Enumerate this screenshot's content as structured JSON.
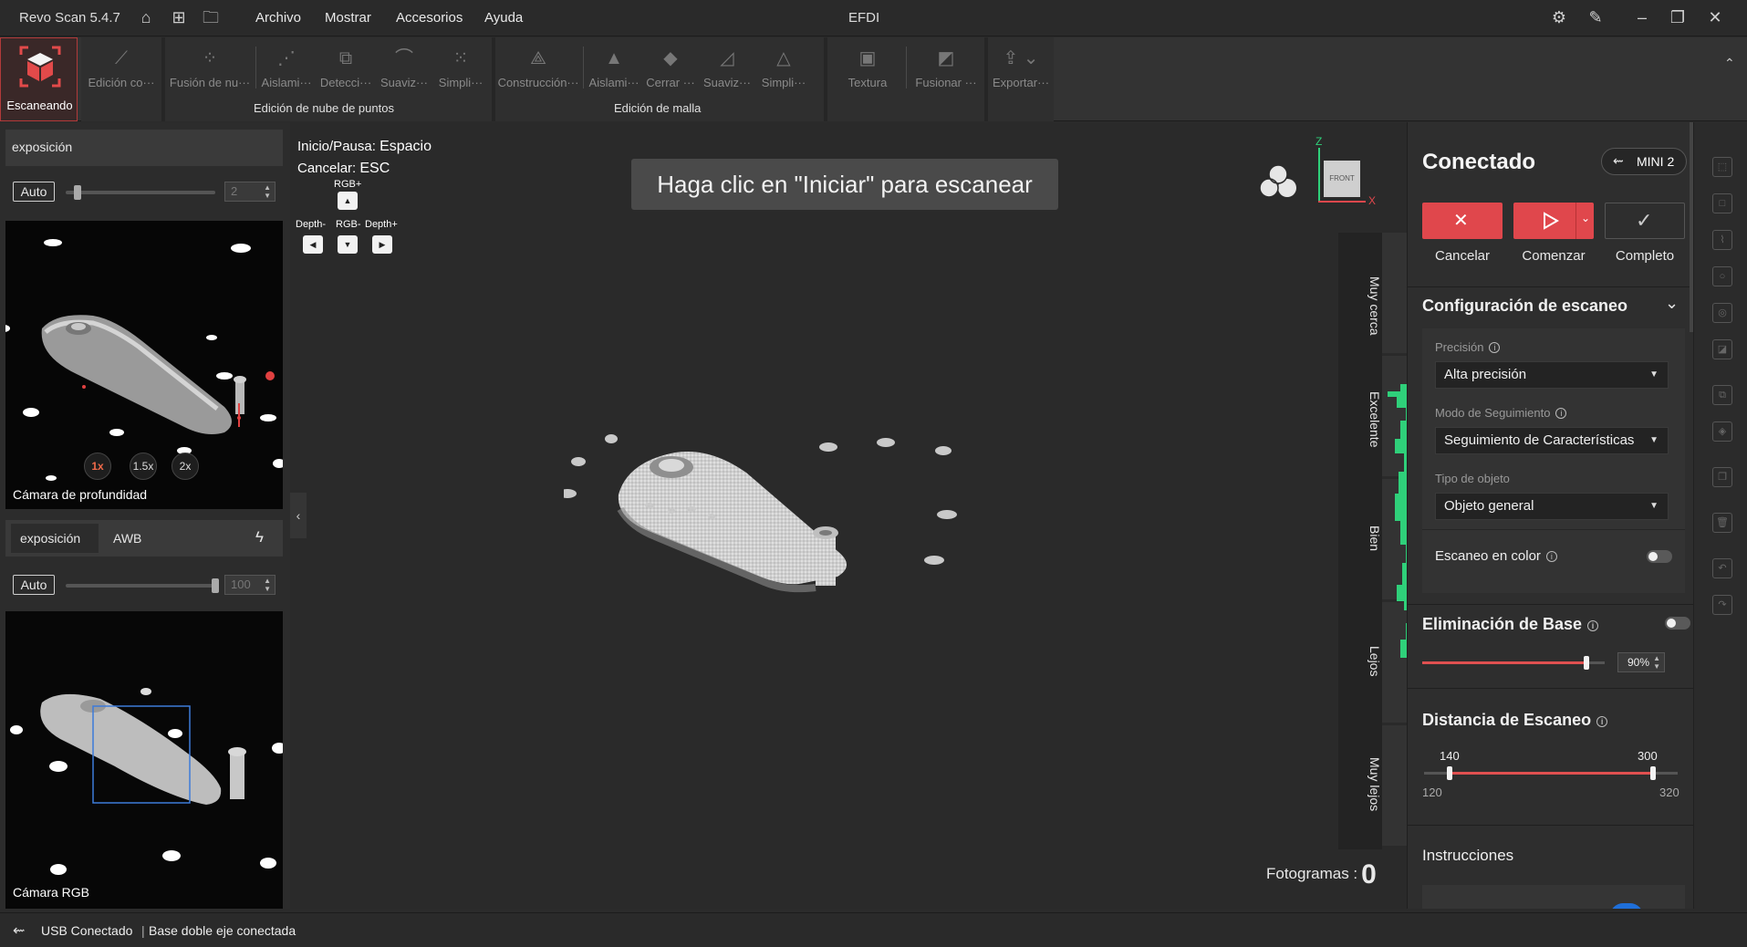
{
  "titlebar": {
    "app_name": "Revo Scan 5.4.7",
    "window_title": "EFDI",
    "menu": [
      "Archivo",
      "Mostrar",
      "Accesorios",
      "Ayuda"
    ]
  },
  "toolbar": {
    "scan_label": "Escaneando",
    "point_cloud_tools": [
      "Edición co···",
      "Fusión de nu···",
      "Aislami···",
      "Detecci···",
      "Suaviz···",
      "Simpli···"
    ],
    "point_cloud_group": "Edición de nube de puntos",
    "mesh_tools": [
      "Construcción···",
      "Aislami···",
      "Cerrar ···",
      "Suaviz···",
      "Simpli···"
    ],
    "mesh_group": "Edición de malla",
    "texture_tools": [
      "Textura",
      "Fusionar ···"
    ],
    "export_label": "Exportar···"
  },
  "left_panel": {
    "depth": {
      "exposure_label": "exposición",
      "auto_label": "Auto",
      "value": "2",
      "level": 0.08,
      "zoom_options": [
        "1x",
        "1.5x",
        "2x"
      ],
      "camera_label": "Cámara de profundidad"
    },
    "rgb": {
      "tab_exposure": "exposición",
      "tab_awb": "AWB",
      "auto_label": "Auto",
      "value": "100",
      "level": 1.0,
      "camera_label": "Cámara RGB"
    }
  },
  "viewport": {
    "start_pause_label": "Inicio/Pausa:",
    "start_pause_key": "Espacio",
    "cancel_label": "Cancelar:",
    "cancel_key": "ESC",
    "rgb_plus": "RGB+",
    "depth_minus": "Depth-",
    "rgb_minus": "RGB-",
    "depth_plus": "Depth+",
    "hint": "Haga clic en \"Iniciar\" para escanear",
    "axis_z": "Z",
    "axis_x": "X",
    "cube_face": "FRONT",
    "distance_labels": [
      "Muy cerca",
      "Excelente",
      "Bien",
      "Lejos",
      "Muy lejos"
    ],
    "frames_label": "Fotogramas :",
    "frames_value": "0"
  },
  "right_panel": {
    "status": "Conectado",
    "device": "MINI 2",
    "cancel_label": "Cancelar",
    "start_label": "Comenzar",
    "complete_label": "Completo",
    "scan_config": {
      "title": "Configuración de escaneo",
      "precision_label": "Precisión",
      "precision_value": "Alta precisión",
      "tracking_label": "Modo de Seguimiento",
      "tracking_value": "Seguimiento de Características",
      "object_label": "Tipo de objeto",
      "object_value": "Objeto general",
      "color_scan_label": "Escaneo en color"
    },
    "base_removal": {
      "title": "Eliminación de Base",
      "value": "90%",
      "level": 0.9
    },
    "scan_distance": {
      "title": "Distancia de Escaneo",
      "low": "140",
      "high": "300",
      "min": "120",
      "max": "320"
    },
    "instructions_title": "Instrucciones"
  },
  "statusbar": {
    "usb": "USB Conectado",
    "separator": "|",
    "base": "Base doble eje conectada"
  },
  "colors": {
    "accent_red": "#e0474c",
    "green_histogram": "#2fd07a",
    "selection_blue": "#3d7bd9"
  }
}
